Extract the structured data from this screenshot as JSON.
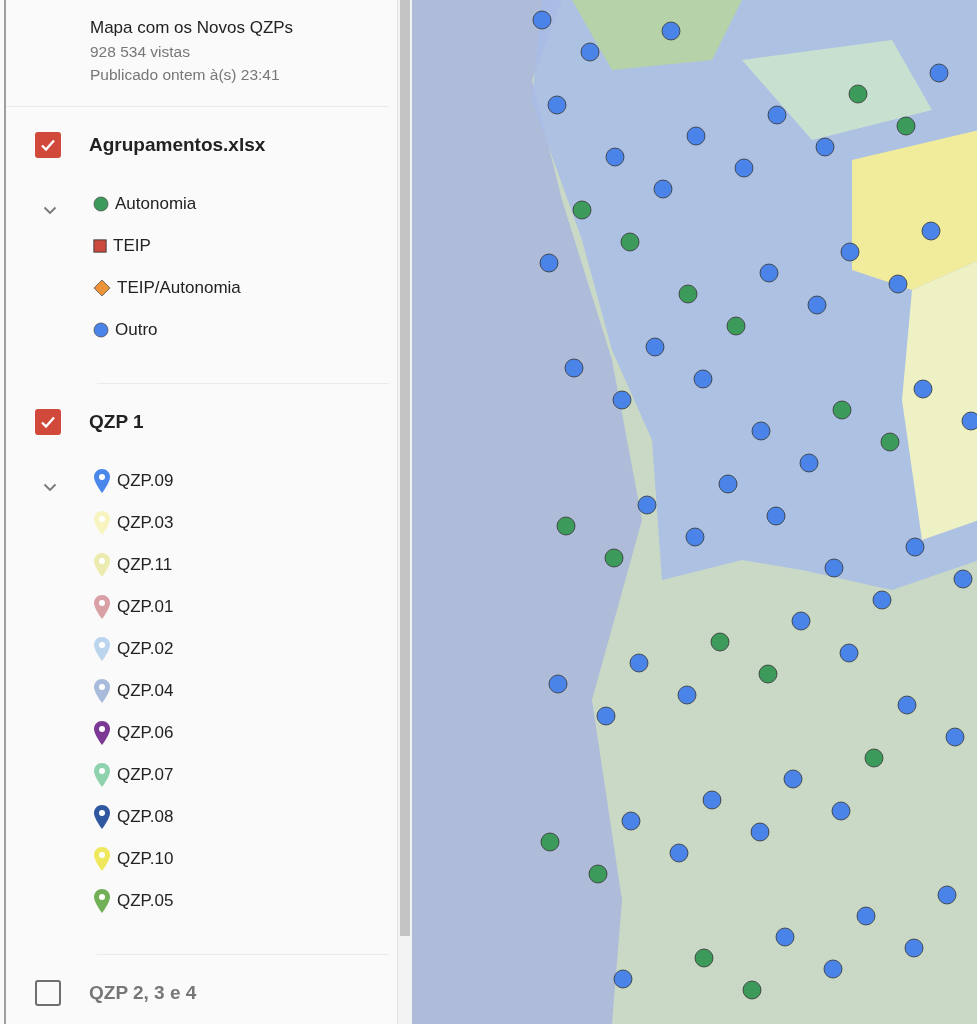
{
  "map_info": {
    "title": "Mapa com os Novos QZPs",
    "views": "928 534 vistas",
    "published": "Publicado ontem à(s) 23:41"
  },
  "layers": [
    {
      "name": "Agrupamentos.xlsx",
      "checked": true,
      "expanded": true,
      "items": [
        {
          "label": "Autonomia",
          "kind": "circle",
          "color": "#3c9a5a"
        },
        {
          "label": "TEIP",
          "kind": "square",
          "color": "#cc4a3c"
        },
        {
          "label": "TEIP/Autonomia",
          "kind": "diamond",
          "color": "#ec9338"
        },
        {
          "label": "Outro",
          "kind": "circle",
          "color": "#4b84e8"
        }
      ]
    },
    {
      "name": "QZP 1",
      "checked": true,
      "expanded": true,
      "items": [
        {
          "label": "QZP.09",
          "kind": "pin",
          "color": "#4a87ea"
        },
        {
          "label": "QZP.03",
          "kind": "pin",
          "color": "#f7f4c0"
        },
        {
          "label": "QZP.11",
          "kind": "pin",
          "color": "#ecebb0"
        },
        {
          "label": "QZP.01",
          "kind": "pin",
          "color": "#d9a0a6"
        },
        {
          "label": "QZP.02",
          "kind": "pin",
          "color": "#bcd5ee"
        },
        {
          "label": "QZP.04",
          "kind": "pin",
          "color": "#a9bbdb"
        },
        {
          "label": "QZP.06",
          "kind": "pin",
          "color": "#7b3894"
        },
        {
          "label": "QZP.07",
          "kind": "pin",
          "color": "#8fd2ae"
        },
        {
          "label": "QZP.08",
          "kind": "pin",
          "color": "#2f58a0"
        },
        {
          "label": "QZP.10",
          "kind": "pin",
          "color": "#efe85c"
        },
        {
          "label": "QZP.05",
          "kind": "pin",
          "color": "#72b057"
        }
      ]
    },
    {
      "name": "QZP 2, 3 e 4",
      "checked": false
    }
  ]
}
